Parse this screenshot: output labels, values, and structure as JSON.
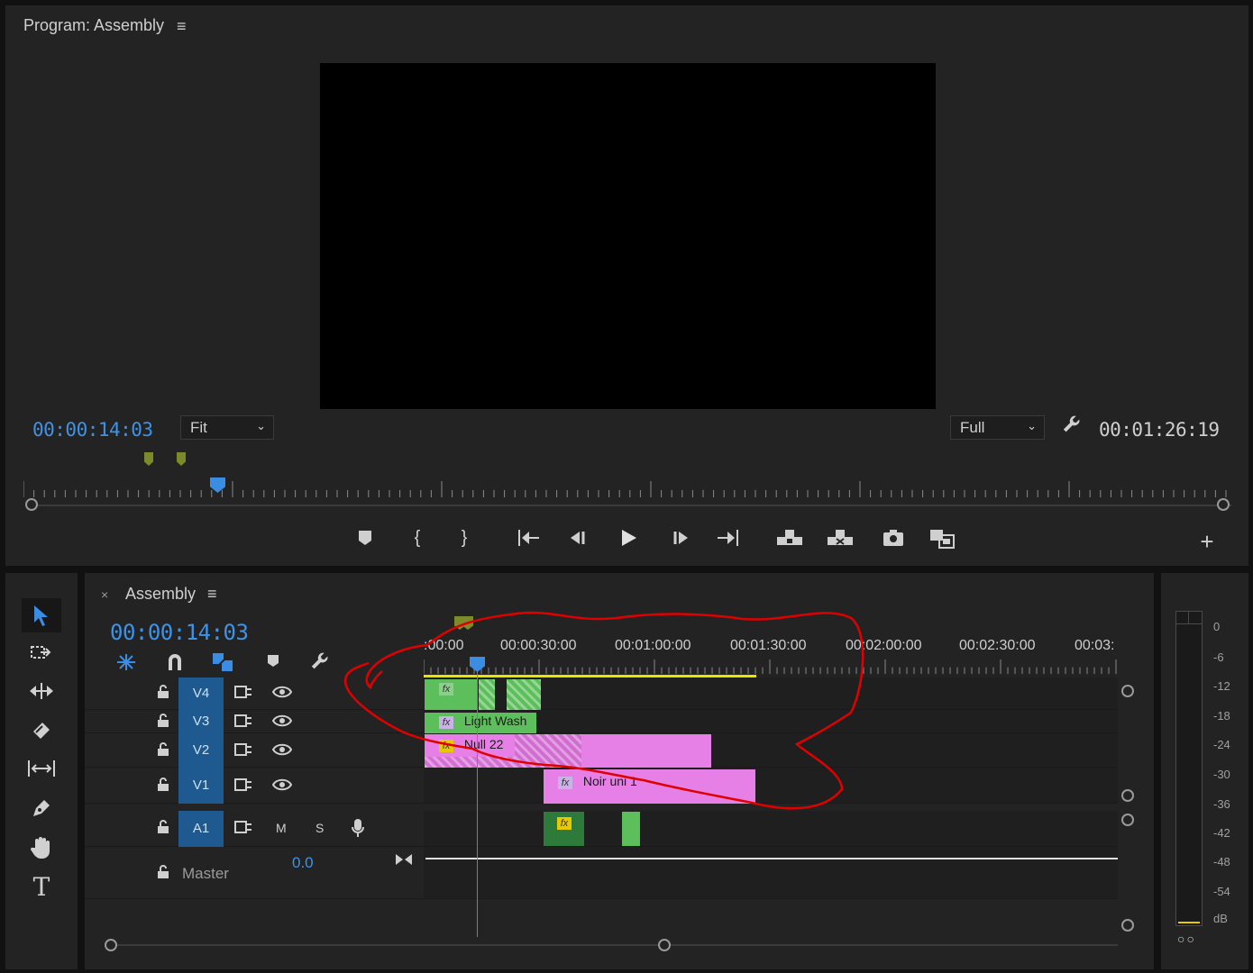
{
  "program": {
    "title": "Program: Assembly",
    "menu_icon": "≡",
    "timecode_current": "00:00:14:03",
    "zoom": "Fit",
    "resolution": "Full",
    "timecode_duration": "00:01:26:19"
  },
  "controls": {
    "add_marker": "add-marker-icon",
    "mark_in": "mark-in-icon",
    "mark_out": "mark-out-icon",
    "go_to_in": "go-to-in-icon",
    "step_back": "step-back-icon",
    "play": "play-icon",
    "step_forward": "step-forward-icon",
    "go_to_out": "go-to-out-icon",
    "lift": "lift-icon",
    "extract": "extract-icon",
    "export_frame": "camera-icon",
    "compare": "compare-view-icon",
    "button_editor": "+"
  },
  "timeline": {
    "tab_close": "×",
    "title": "Assembly",
    "menu_icon": "≡",
    "timecode": "00:00:14:03",
    "ruler_labels": [
      ":00:00",
      "00:00:30:00",
      "00:01:00:00",
      "00:01:30:00",
      "00:02:00:00",
      "00:02:30:00",
      "00:03:"
    ],
    "tracks": {
      "v4": "V4",
      "v3": "V3",
      "v2": "V2",
      "v1": "V1",
      "a1": "A1",
      "mute": "M",
      "solo": "S",
      "master": "Master",
      "master_value": "0.0"
    },
    "clips": {
      "fx": "fx",
      "light_wash": "Light Wash",
      "null_22": "Null 22",
      "noir_uni": "Noir uni 1"
    }
  },
  "meter": {
    "db_labels": [
      "0",
      "-6",
      "-12",
      "-18",
      "-24",
      "-30",
      "-36",
      "-42",
      "-48",
      "-54",
      "dB"
    ],
    "solo_buttons": "○○"
  },
  "colors": {
    "accent_blue": "#3d93e8",
    "track_label": "#1e5a8f",
    "clip_green": "#5cbf5c",
    "clip_pink": "#e680e6",
    "marker": "#7d8a2c",
    "annotation_red": "#e00000"
  }
}
